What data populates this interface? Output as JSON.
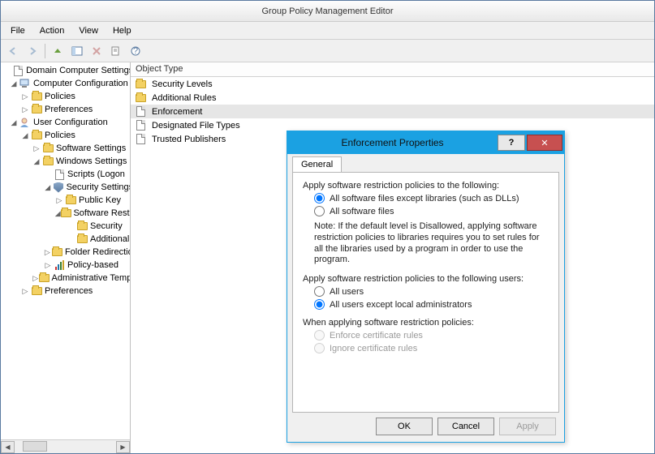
{
  "window": {
    "title": "Group Policy Management Editor"
  },
  "menubar": {
    "file": "File",
    "action": "Action",
    "view": "View",
    "help": "Help"
  },
  "toolbar_icons": [
    "back",
    "forward",
    "up",
    "props",
    "refresh",
    "export",
    "help"
  ],
  "tree": {
    "root": "Domain Computer Settings",
    "comp_cfg": "Computer Configuration",
    "comp_policies": "Policies",
    "comp_prefs": "Preferences",
    "user_cfg": "User Configuration",
    "user_policies": "Policies",
    "software_settings": "Software Settings",
    "windows_settings": "Windows Settings",
    "scripts": "Scripts (Logon",
    "security_settings": "Security Settings",
    "public_key": "Public Key",
    "software_restriction": "Software Restriction",
    "srp_security": "Security",
    "srp_additional": "Additional",
    "folder_redirect": "Folder Redirection",
    "policy_based": "Policy-based",
    "admin_templates": "Administrative Templates",
    "user_prefs": "Preferences"
  },
  "list": {
    "header": "Object Type",
    "items": [
      {
        "label": "Security Levels",
        "icon": "folder"
      },
      {
        "label": "Additional Rules",
        "icon": "folder"
      },
      {
        "label": "Enforcement",
        "icon": "doc",
        "selected": true
      },
      {
        "label": "Designated File Types",
        "icon": "doc"
      },
      {
        "label": "Trusted Publishers",
        "icon": "doc"
      }
    ]
  },
  "dialog": {
    "title": "Enforcement Properties",
    "help_glyph": "?",
    "close_glyph": "✕",
    "tab_general": "General",
    "section1": {
      "heading": "Apply software restriction policies to the following:",
      "opt1": "All software files except libraries (such as DLLs)",
      "opt2": "All software files",
      "selected": "opt1",
      "note": "Note:  If the default level is Disallowed, applying software restriction policies to libraries requires you to set rules for all the libraries used by a program in order to use the program."
    },
    "section2": {
      "heading": "Apply software restriction policies to the following users:",
      "opt1": "All users",
      "opt2": "All users except local administrators",
      "selected": "opt2"
    },
    "section3": {
      "heading": "When applying software restriction policies:",
      "opt1": "Enforce certificate rules",
      "opt2": "Ignore certificate rules",
      "disabled": true
    },
    "buttons": {
      "ok": "OK",
      "cancel": "Cancel",
      "apply": "Apply"
    }
  }
}
